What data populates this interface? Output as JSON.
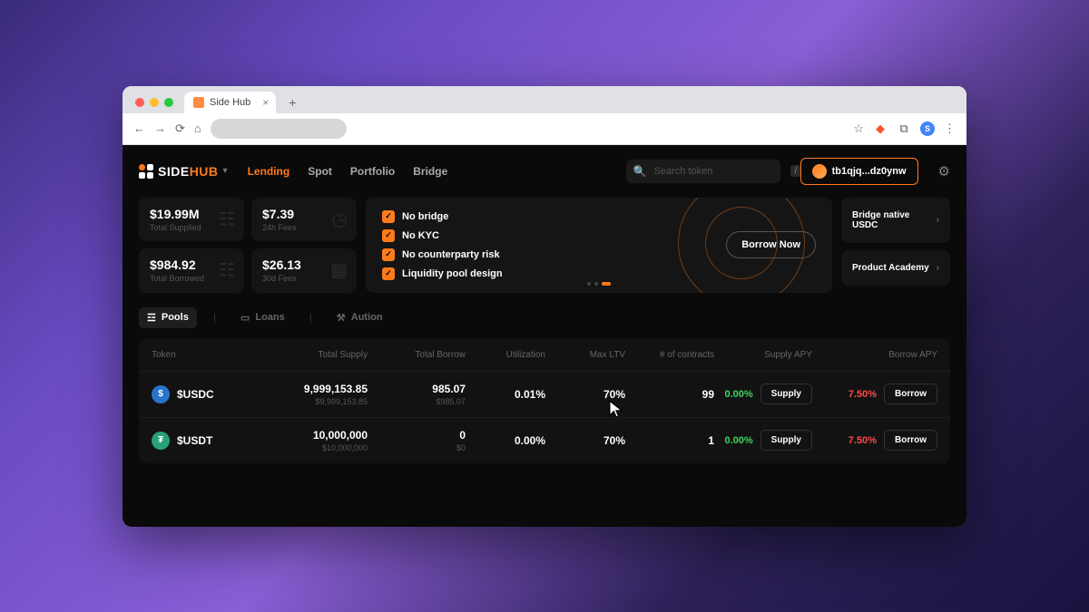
{
  "browser": {
    "tab_title": "Side Hub",
    "avatar_letter": "S"
  },
  "app": {
    "logo_a": "SIDE",
    "logo_b": "HUB",
    "nav": [
      "Lending",
      "Spot",
      "Portfolio",
      "Bridge"
    ],
    "search_placeholder": "Search token",
    "search_key": "/",
    "wallet": "tb1qjq...dz0ynw"
  },
  "stats": [
    {
      "value": "$19.99M",
      "label": "Total Supplied"
    },
    {
      "value": "$7.39",
      "label": "24h Fees"
    },
    {
      "value": "$984.92",
      "label": "Total Borrowed"
    },
    {
      "value": "$26.13",
      "label": "30d Fees"
    }
  ],
  "promo": {
    "features": [
      "No bridge",
      "No KYC",
      "No counterparty risk",
      "Liquidity pool design"
    ],
    "cta": "Borrow Now"
  },
  "side_links": [
    "Bridge native USDC",
    "Product Academy"
  ],
  "subtabs": [
    "Pools",
    "Loans",
    "Aution"
  ],
  "table": {
    "headers": [
      "Token",
      "Total Supply",
      "Total Borrow",
      "Utilization",
      "Max LTV",
      "# of contracts",
      "Supply APY",
      "Borrow APY"
    ],
    "rows": [
      {
        "symbol": "$USDC",
        "coin_class": "usdc",
        "coin_letter": "$",
        "supply": "9,999,153.85",
        "supply_sub": "$9,999,153.85",
        "borrow": "985.07",
        "borrow_sub": "$985.07",
        "util": "0.01%",
        "ltv": "70%",
        "contracts": "99",
        "supply_apy": "0.00%",
        "borrow_apy": "7.50%",
        "supply_btn": "Supply",
        "borrow_btn": "Borrow"
      },
      {
        "symbol": "$USDT",
        "coin_class": "usdt",
        "coin_letter": "₮",
        "supply": "10,000,000",
        "supply_sub": "$10,000,000",
        "borrow": "0",
        "borrow_sub": "$0",
        "util": "0.00%",
        "ltv": "70%",
        "contracts": "1",
        "supply_apy": "0.00%",
        "borrow_apy": "7.50%",
        "supply_btn": "Supply",
        "borrow_btn": "Borrow"
      }
    ]
  }
}
